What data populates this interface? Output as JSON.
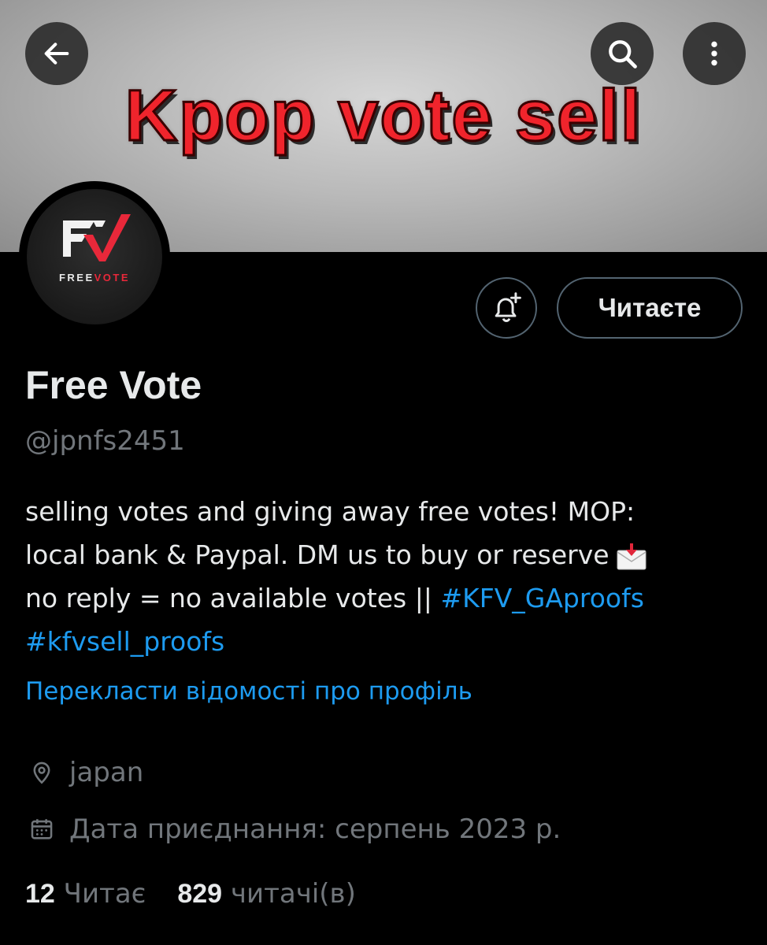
{
  "banner": {
    "text": "Kpop vote sell"
  },
  "header": {
    "back_icon": "arrow-left-icon",
    "search_icon": "search-icon",
    "more_icon": "more-vertical-icon"
  },
  "avatar": {
    "word1": "FREE",
    "word2": "VOTE"
  },
  "actions": {
    "notify_icon": "bell-plus-icon",
    "follow_label": "Читаєте"
  },
  "profile": {
    "name": "Free Vote",
    "handle": "@jpnfs2451",
    "bio_line1": "selling votes and giving away free votes! MOP:",
    "bio_line2": "local bank & Paypal. DM us to buy or reserve",
    "bio_line3": "no reply = no available votes ||",
    "hashtag1": "#KFV_GAproofs",
    "hashtag2": "#kfvsell_proofs",
    "translate_link": "Перекласти відомості про профіль",
    "location": "japan",
    "joined": "Дата приєднання: серпень 2023 р."
  },
  "stats": {
    "following_count": "12",
    "following_label": "Читає",
    "followers_count": "829",
    "followers_label": "читачі(в)"
  },
  "colors": {
    "accent": "#1d9bf0",
    "muted": "#71767b",
    "text": "#e7e9ea",
    "brand_red": "#e8283a"
  }
}
